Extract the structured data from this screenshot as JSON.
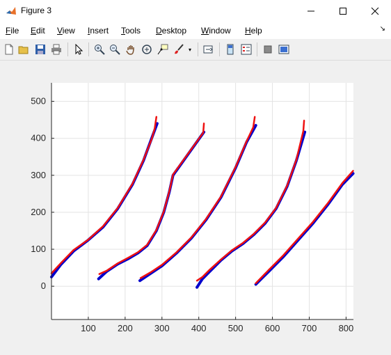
{
  "window": {
    "title": "Figure 3"
  },
  "menu": [
    {
      "label": "File",
      "key": "F",
      "rest": "ile"
    },
    {
      "label": "Edit",
      "key": "E",
      "rest": "dit"
    },
    {
      "label": "View",
      "key": "V",
      "rest": "iew"
    },
    {
      "label": "Insert",
      "key": "I",
      "rest": "nsert"
    },
    {
      "label": "Tools",
      "key": "T",
      "rest": "ools"
    },
    {
      "label": "Desktop",
      "key": "D",
      "rest": "esktop"
    },
    {
      "label": "Window",
      "key": "W",
      "rest": "indow"
    },
    {
      "label": "Help",
      "key": "H",
      "rest": "elp"
    }
  ],
  "toolbar_icons": [
    "new-figure-icon",
    "open-file-icon",
    "save-icon",
    "print-icon",
    "edit-plot-icon",
    "zoom-in-icon",
    "zoom-out-icon",
    "pan-icon",
    "rotate-3d-icon",
    "data-cursor-icon",
    "brush-icon",
    "link-plot-icon",
    "insert-colorbar-icon",
    "insert-legend-icon",
    "hide-plot-tools-icon",
    "show-plot-tools-icon"
  ],
  "chart_data": {
    "type": "line",
    "xlim": [
      0,
      820
    ],
    "ylim": [
      -90,
      550
    ],
    "xticks": [
      100,
      200,
      300,
      400,
      500,
      600,
      700,
      800
    ],
    "yticks": [
      0,
      100,
      200,
      300,
      400,
      500
    ],
    "grid": true,
    "colors": {
      "series_a": "#0000cc",
      "series_b": "#ee1111"
    },
    "series": [
      {
        "color": "#0000cc",
        "segments": [
          {
            "x": [
              0,
              25,
              60,
              100,
              140,
              180,
              220,
              250,
              272,
              287
            ],
            "y": [
              25,
              58,
              95,
              125,
              160,
              210,
              275,
              340,
              400,
              440
            ]
          },
          {
            "x": [
              128,
              150,
              180,
              210,
              235,
              260,
              285,
              305,
              320,
              330,
              414
            ],
            "y": [
              20,
              40,
              60,
              75,
              90,
              110,
              150,
              200,
              255,
              300,
              417
            ]
          },
          {
            "x": [
              240,
              270,
              300,
              340,
              380,
              420,
              460,
              500,
              530,
              555
            ],
            "y": [
              15,
              35,
              55,
              90,
              130,
              180,
              240,
              320,
              390,
              435
            ]
          },
          {
            "x": [
              395,
              410,
              430,
              460,
              490,
              520,
              550,
              580,
              610,
              640,
              665,
              688
            ],
            "y": [
              -3,
              20,
              40,
              70,
              95,
              115,
              140,
              170,
              210,
              270,
              340,
              417
            ]
          },
          {
            "x": [
              555,
              590,
              630,
              670,
              710,
              750,
              790,
              819
            ],
            "y": [
              5,
              40,
              80,
              125,
              170,
              220,
              275,
              305
            ]
          }
        ]
      },
      {
        "color": "#ee1111",
        "segments": [
          {
            "x": [
              0,
              25,
              60,
              100,
              140,
              180,
              220,
              250,
              272,
              280,
              285
            ],
            "y": [
              35,
              62,
              98,
              126,
              162,
              212,
              277,
              342,
              398,
              425,
              458
            ]
          },
          {
            "x": [
              130,
              150,
              180,
              210,
              235,
              260,
              285,
              305,
              320,
              330,
              412,
              414
            ],
            "y": [
              33,
              42,
              62,
              78,
              92,
              112,
              152,
              202,
              257,
              302,
              415,
              440
            ]
          },
          {
            "x": [
              242,
              270,
              300,
              340,
              380,
              420,
              460,
              500,
              530,
              548,
              552
            ],
            "y": [
              22,
              38,
              58,
              92,
              132,
              182,
              242,
              322,
              392,
              430,
              458
            ]
          },
          {
            "x": [
              395,
              410,
              430,
              460,
              490,
              520,
              550,
              580,
              610,
              640,
              665,
              684,
              686
            ],
            "y": [
              15,
              25,
              45,
              72,
              97,
              117,
              142,
              172,
              212,
              272,
              342,
              420,
              448
            ]
          },
          {
            "x": [
              555,
              590,
              630,
              670,
              710,
              750,
              790,
              819
            ],
            "y": [
              8,
              44,
              84,
              129,
              174,
              224,
              279,
              312
            ]
          }
        ]
      }
    ]
  }
}
